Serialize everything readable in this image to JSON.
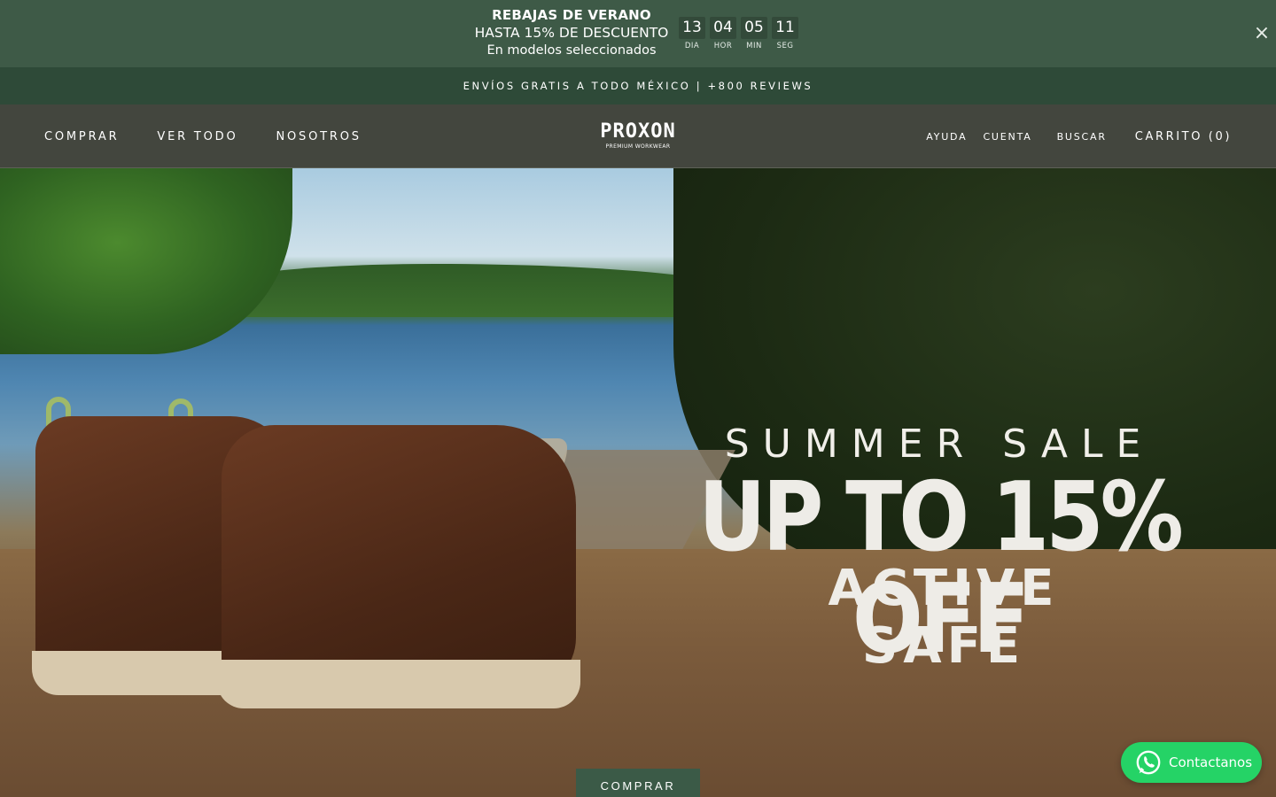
{
  "announcement": {
    "title": "REBAJAS DE VERANO",
    "subtitle": "HASTA 15% DE DESCUENTO",
    "note": "En modelos seleccionados",
    "countdown": [
      {
        "value": "13",
        "label": "DIA"
      },
      {
        "value": "04",
        "label": "HOR"
      },
      {
        "value": "05",
        "label": "MIN"
      },
      {
        "value": "11",
        "label": "SEG"
      }
    ],
    "close_icon": "×"
  },
  "shipping_bar": {
    "text": "ENVÍOS GRATIS A TODO MÉXICO | +800 REVIEWS"
  },
  "header": {
    "nav_left": [
      "COMPRAR",
      "VER TODO",
      "NOSOTROS"
    ],
    "logo": {
      "word": "PROXON",
      "tagline": "PREMIUM WORKWEAR"
    },
    "nav_right": {
      "help": "AYUDA",
      "account": "CUENTA",
      "search": "BUSCAR",
      "cart": "CARRITO (0)"
    }
  },
  "hero": {
    "eyebrow": "SUMMER SALE",
    "headline": "UP TO 15% OFF",
    "sub": "ACTIVE SAFE",
    "cta": "COMPRAR"
  },
  "chat": {
    "label": "Contactanos",
    "icon": "whatsapp-icon",
    "color": "#25d366"
  },
  "colors": {
    "announcement_bg": "#3e5a47",
    "shipping_bg": "#2e4a38",
    "header_bg": "#43463e",
    "cta_bg": "#3b5a47"
  }
}
